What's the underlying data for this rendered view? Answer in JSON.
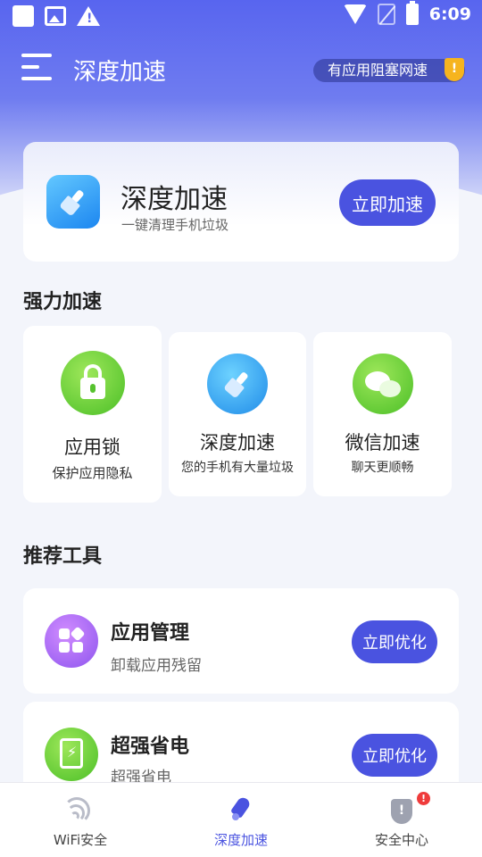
{
  "status_bar": {
    "time": "6:09"
  },
  "header": {
    "title": "深度加速",
    "alert_text": "有应用阻塞网速",
    "alert_mark": "!"
  },
  "hero": {
    "title": "深度加速",
    "subtitle": "一键清理手机垃圾",
    "button": "立即加速"
  },
  "section1": {
    "title": "强力加速",
    "cards": [
      {
        "title": "应用锁",
        "subtitle": "保护应用隐私",
        "icon": "lock-icon"
      },
      {
        "title": "深度加速",
        "subtitle": "您的手机有大量垃圾",
        "icon": "broom-icon"
      },
      {
        "title": "微信加速",
        "subtitle": "聊天更顺畅",
        "icon": "wechat-icon"
      }
    ]
  },
  "section2": {
    "title": "推荐工具",
    "tools": [
      {
        "title": "应用管理",
        "subtitle": "卸载应用残留",
        "button": "立即优化",
        "icon": "apps-grid-icon"
      },
      {
        "title": "超强省电",
        "subtitle": "超强省电",
        "button": "立即优化",
        "icon": "battery-charge-icon"
      }
    ]
  },
  "bottom_nav": {
    "items": [
      {
        "label": "WiFi安全",
        "icon": "wifi-icon",
        "active": false
      },
      {
        "label": "深度加速",
        "icon": "rocket-icon",
        "active": true
      },
      {
        "label": "安全中心",
        "icon": "shield-icon",
        "active": false
      }
    ],
    "badge": "!"
  },
  "colors": {
    "accent": "#4a53e0",
    "header_gradient_top": "#5865ef",
    "green_icon": "#4bbf27",
    "blue_icon": "#1f8be8",
    "purple_icon": "#8d55ee",
    "warning": "#f6b41e",
    "badge_red": "#ef3b3b"
  }
}
